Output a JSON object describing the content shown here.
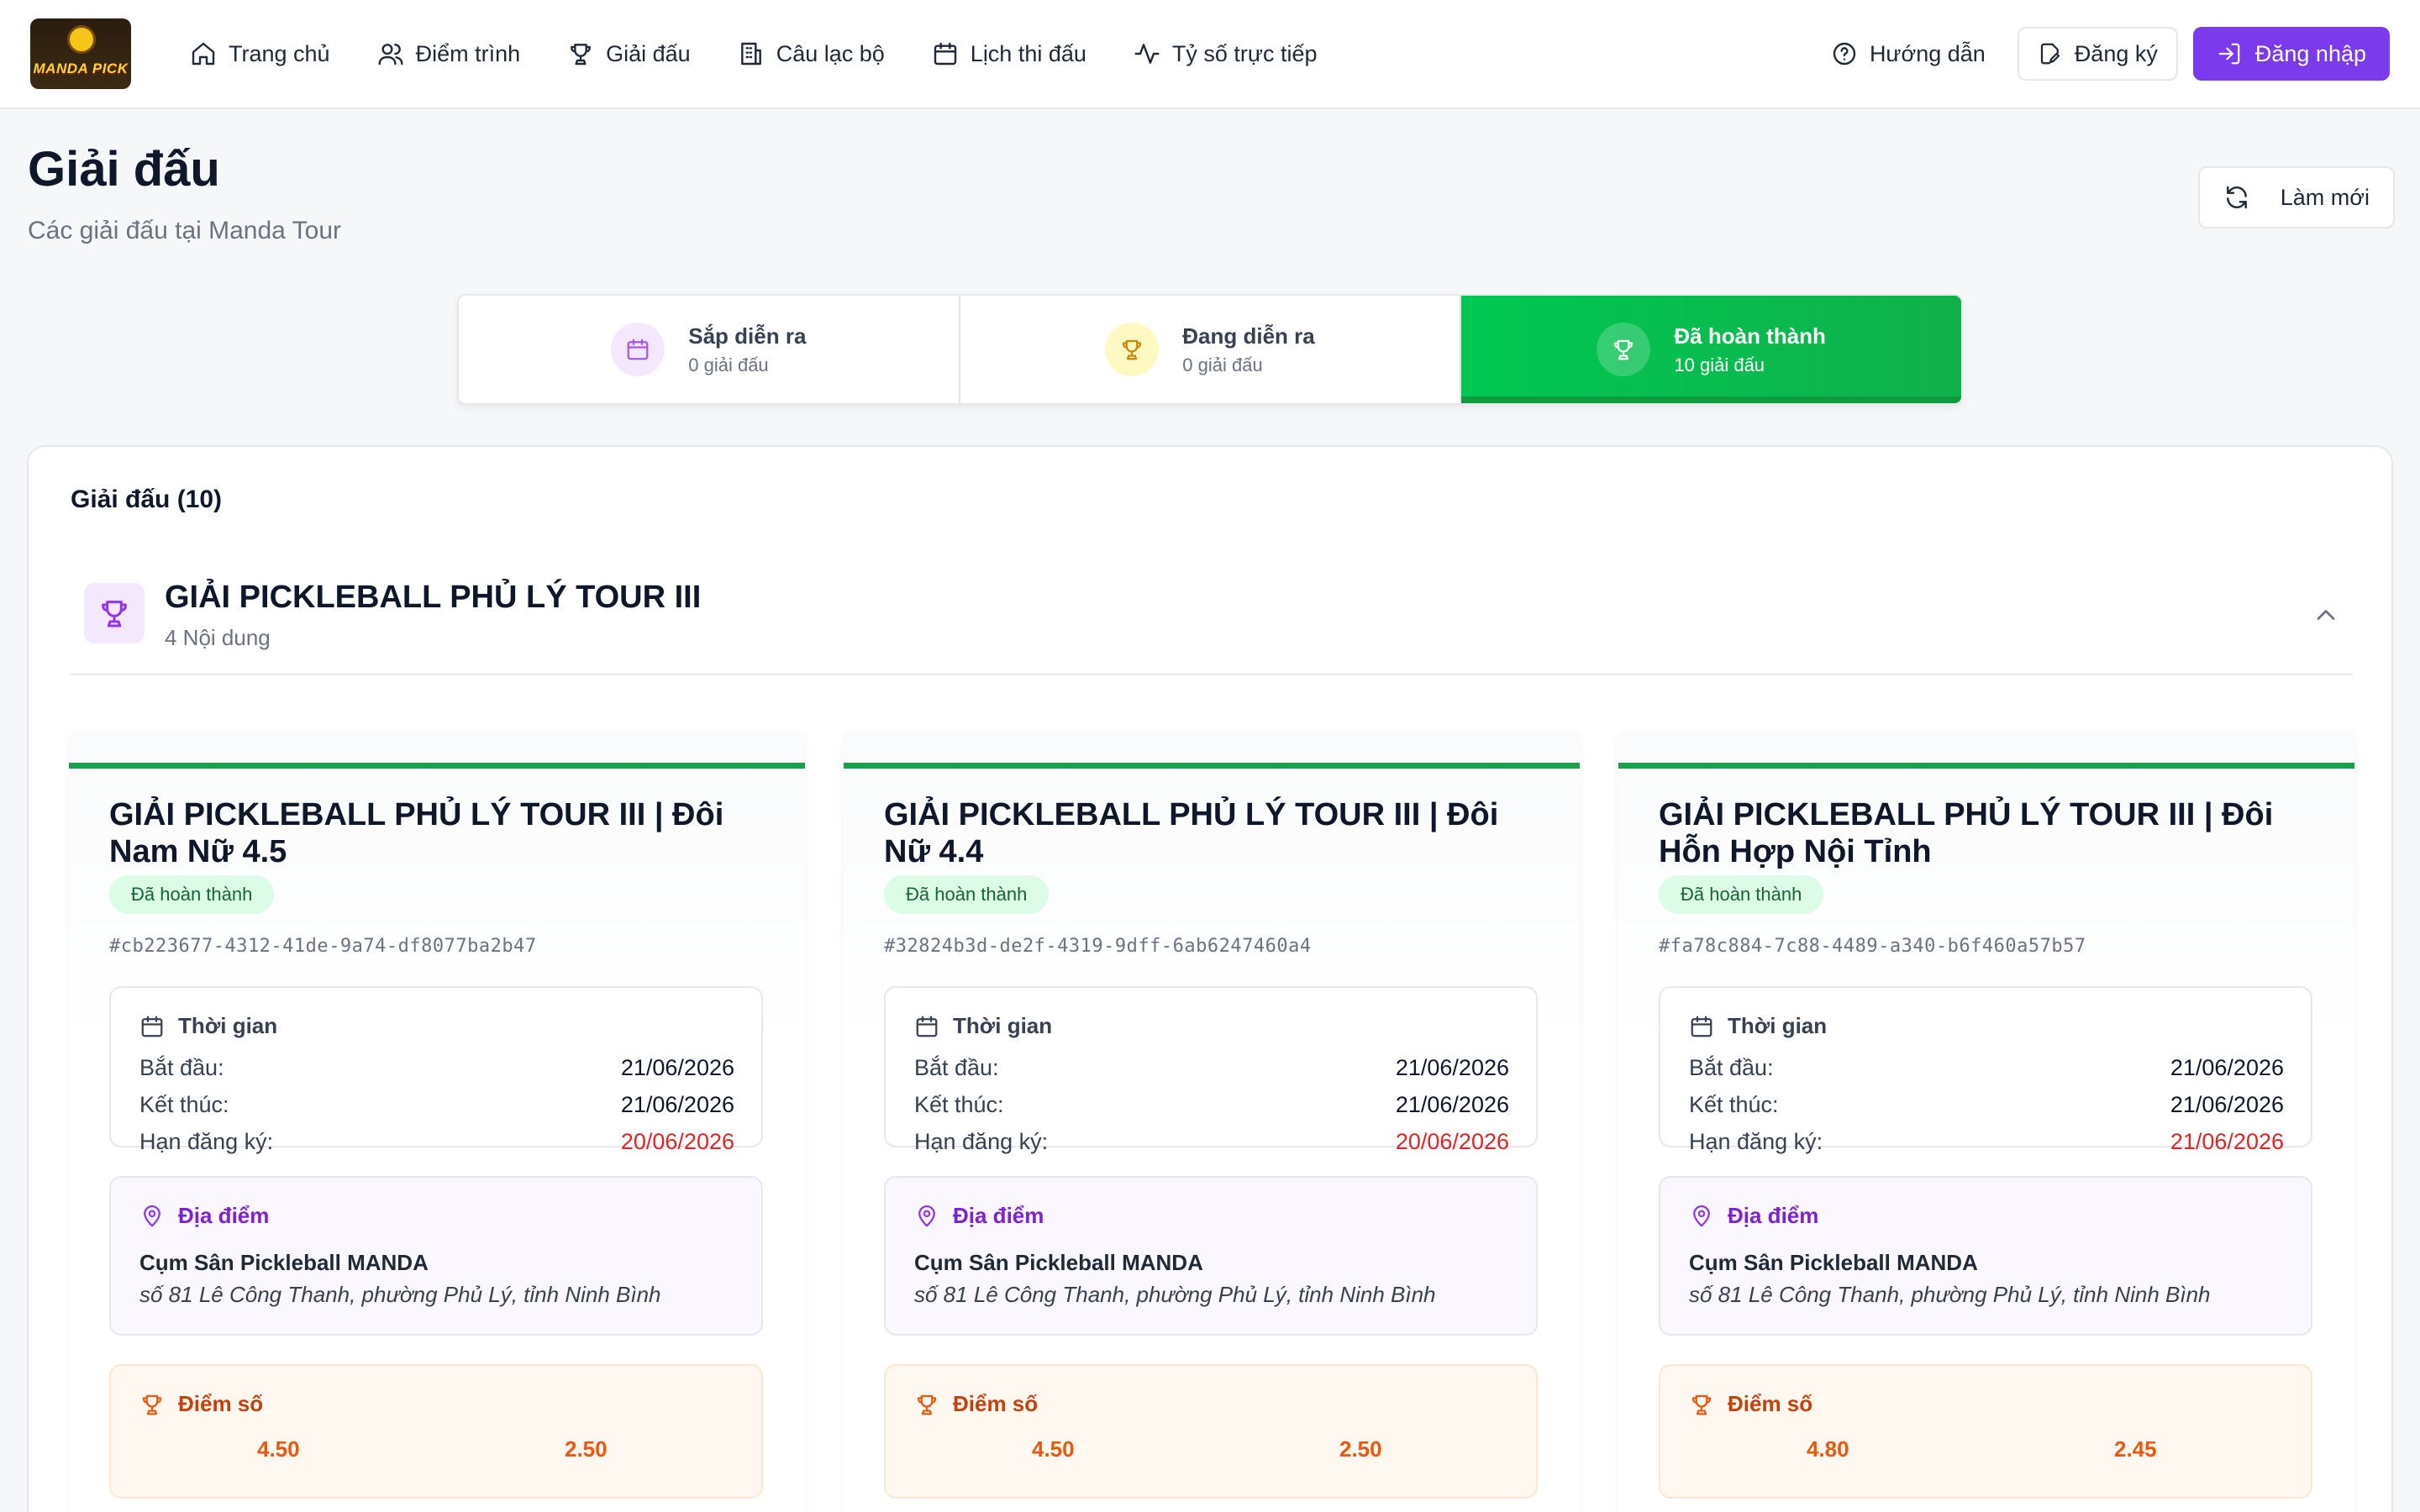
{
  "nav": {
    "logo_text": "MANDA PICK",
    "items": [
      {
        "label": "Trang chủ",
        "icon": "home-icon"
      },
      {
        "label": "Điểm trình",
        "icon": "users-icon"
      },
      {
        "label": "Giải đấu",
        "icon": "trophy-icon"
      },
      {
        "label": "Câu lạc bộ",
        "icon": "building-icon"
      },
      {
        "label": "Lịch thi đấu",
        "icon": "calendar-icon"
      },
      {
        "label": "Tỷ số trực tiếp",
        "icon": "activity-icon"
      }
    ],
    "help_label": "Hướng dẫn",
    "register_label": "Đăng ký",
    "login_label": "Đăng nhập"
  },
  "header": {
    "title": "Giải đấu",
    "subtitle": "Các giải đấu tại Manda Tour",
    "refresh_label": "Làm mới"
  },
  "status_tabs": [
    {
      "label": "Sắp diễn ra",
      "count": "0 giải đấu",
      "icon": "calendar-icon",
      "active": false
    },
    {
      "label": "Đang diễn ra",
      "count": "0 giải đấu",
      "icon": "trophy-icon",
      "active": false
    },
    {
      "label": "Đã hoàn thành",
      "count": "10 giải đấu",
      "icon": "trophy-icon",
      "active": true
    }
  ],
  "panel": {
    "title": "Giải đấu (10)",
    "group": {
      "name": "GIẢI PICKLEBALL PHỦ LÝ TOUR III",
      "sub": "4 Nội dung"
    }
  },
  "cards": [
    {
      "title": "GIẢI PICKLEBALL PHỦ LÝ TOUR III | Đôi Nam Nữ 4.5",
      "status": "Đã hoàn thành",
      "id": "#cb223677-4312-41de-9a74-df8077ba2b47",
      "time_label": "Thời gian",
      "start_label": "Bắt đầu:",
      "start": "21/06/2026",
      "end_label": "Kết thúc:",
      "end": "21/06/2026",
      "deadline_label": "Hạn đăng ký:",
      "deadline": "20/06/2026",
      "location_label": "Địa điểm",
      "place": "Cụm Sân Pickleball MANDA",
      "address": "số 81 Lê Công Thanh, phường Phủ Lý, tỉnh Ninh Bình",
      "score_label": "Điểm số",
      "score_a": "4.50",
      "score_b": "2.50"
    },
    {
      "title": "GIẢI PICKLEBALL PHỦ LÝ TOUR III | Đôi Nữ 4.4",
      "status": "Đã hoàn thành",
      "id": "#32824b3d-de2f-4319-9dff-6ab6247460a4",
      "time_label": "Thời gian",
      "start_label": "Bắt đầu:",
      "start": "21/06/2026",
      "end_label": "Kết thúc:",
      "end": "21/06/2026",
      "deadline_label": "Hạn đăng ký:",
      "deadline": "20/06/2026",
      "location_label": "Địa điểm",
      "place": "Cụm Sân Pickleball MANDA",
      "address": "số 81 Lê Công Thanh, phường Phủ Lý, tỉnh Ninh Bình",
      "score_label": "Điểm số",
      "score_a": "4.50",
      "score_b": "2.50"
    },
    {
      "title": "GIẢI PICKLEBALL PHỦ LÝ TOUR III | Đôi Hỗn Hợp Nội Tỉnh",
      "status": "Đã hoàn thành",
      "id": "#fa78c884-7c88-4489-a340-b6f460a57b57",
      "time_label": "Thời gian",
      "start_label": "Bắt đầu:",
      "start": "21/06/2026",
      "end_label": "Kết thúc:",
      "end": "21/06/2026",
      "deadline_label": "Hạn đăng ký:",
      "deadline": "21/06/2026",
      "location_label": "Địa điểm",
      "place": "Cụm Sân Pickleball MANDA",
      "address": "số 81 Lê Công Thanh, phường Phủ Lý, tỉnh Ninh Bình",
      "score_label": "Điểm số",
      "score_a": "4.80",
      "score_b": "2.45"
    }
  ],
  "colors": {
    "accent_purple": "#7c3aed",
    "active_green": "#00c853",
    "deadline_red": "#dc2626",
    "score_orange": "#ea580c"
  }
}
